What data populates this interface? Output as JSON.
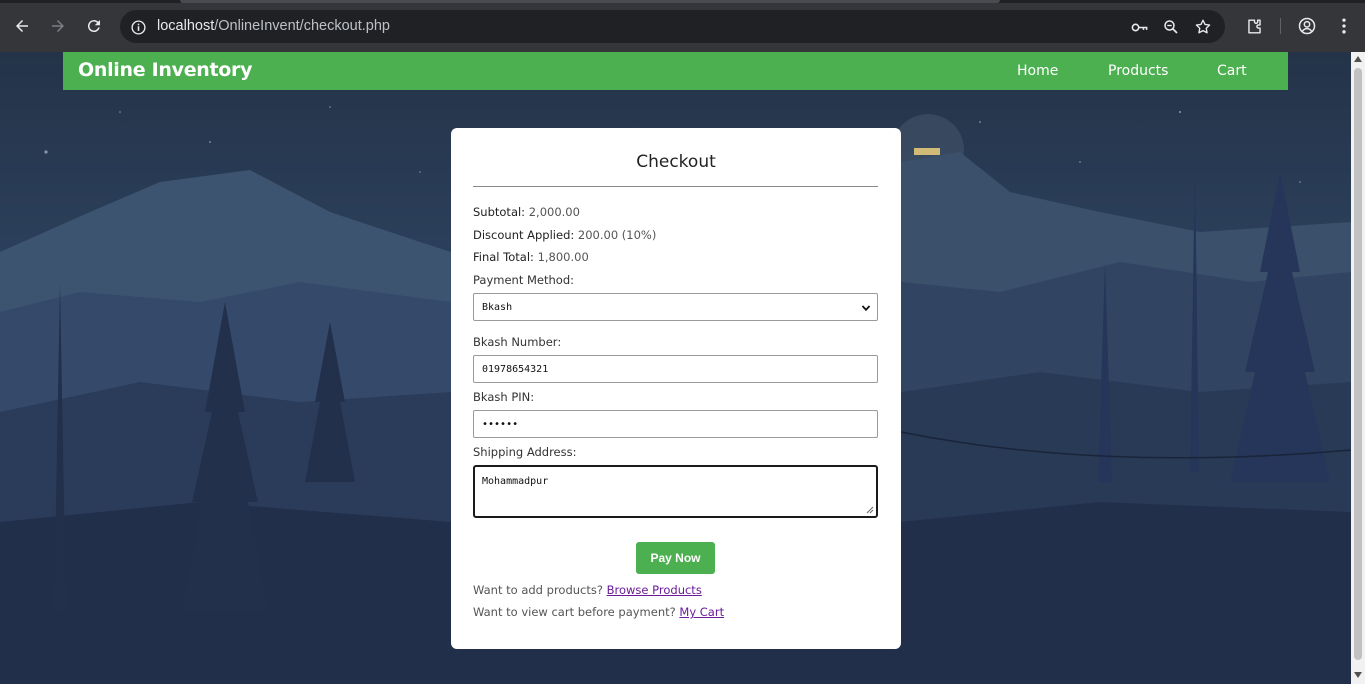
{
  "browser": {
    "url_host": "localhost",
    "url_path": "/OnlineInvent/checkout.php"
  },
  "site": {
    "brand": "Online Inventory",
    "nav": [
      {
        "label": "Home"
      },
      {
        "label": "Products"
      },
      {
        "label": "Cart"
      }
    ],
    "accent_color": "#4caf50"
  },
  "checkout": {
    "title": "Checkout",
    "subtotal_label": "Subtotal:",
    "subtotal_value": "2,000.00",
    "discount_label": "Discount Applied:",
    "discount_value": "200.00 (10%)",
    "final_label": "Final Total:",
    "final_value": "1,800.00",
    "payment_method_label": "Payment Method:",
    "payment_method_value": "Bkash",
    "number_label": "Bkash Number:",
    "number_value": "01978654321",
    "pin_label": "Bkash PIN:",
    "pin_value": "••••••",
    "address_label": "Shipping Address:",
    "address_value": "Mohammadpur",
    "pay_button": "Pay Now",
    "browse_prompt": "Want to add products?",
    "browse_link": "Browse Products",
    "cart_prompt": "Want to view cart before payment?",
    "cart_link": "My Cart"
  }
}
